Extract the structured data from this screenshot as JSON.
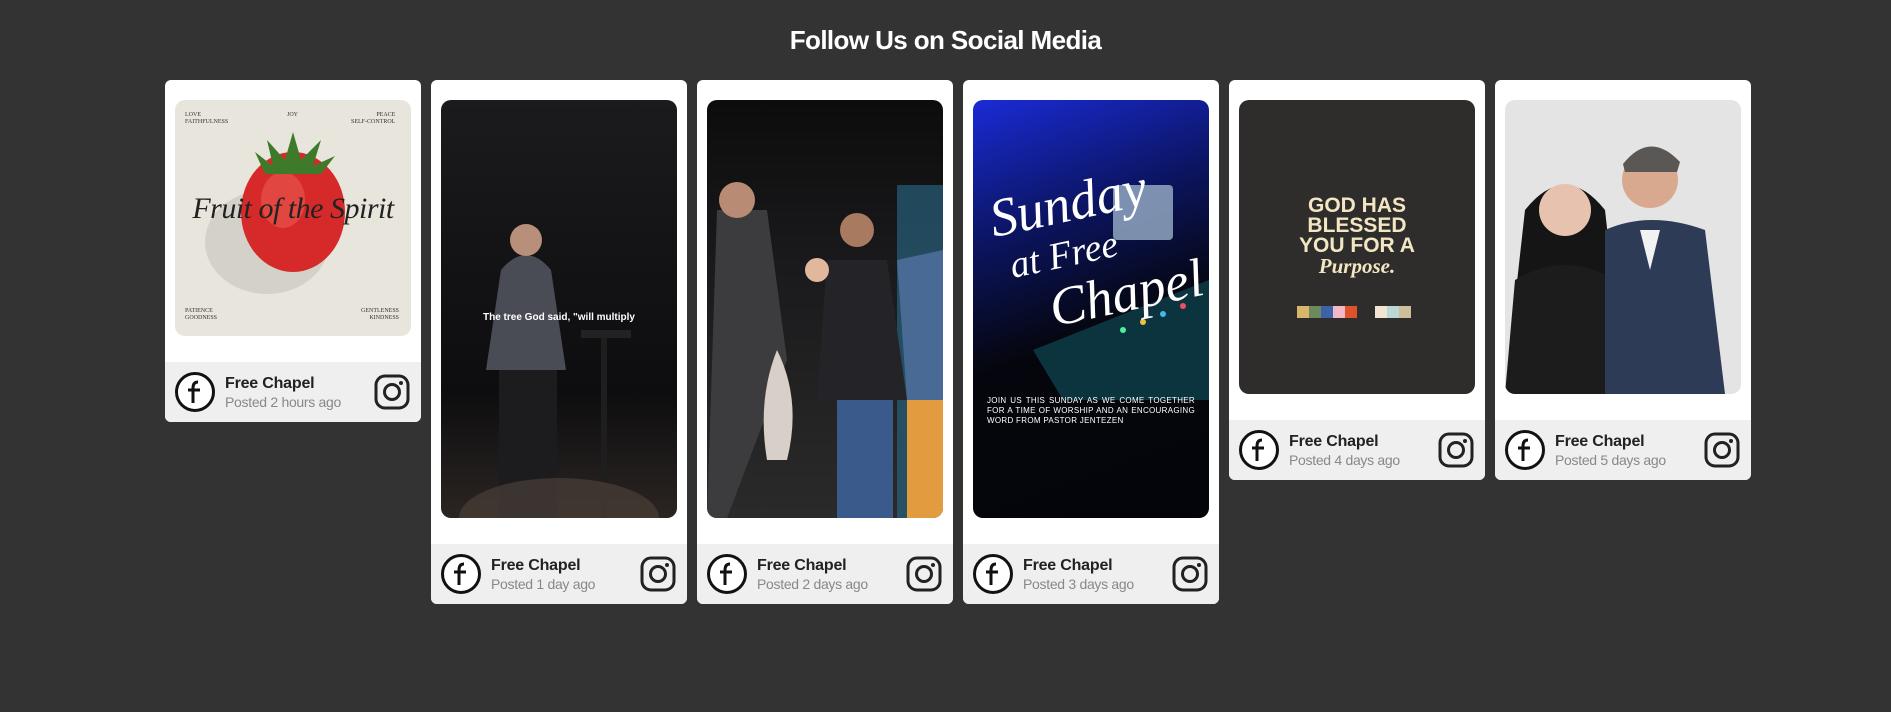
{
  "page": {
    "title": "Follow Us on Social Media"
  },
  "posts": [
    {
      "author": "Free Chapel",
      "posted": "Posted 2 hours ago",
      "image": {
        "corner_tl": "LOVE\nFAITHFULNESS",
        "corner_tc": "JOY",
        "corner_tr": "PEACE\nSELF-CONTROL",
        "script": "Fruit of the Spirit",
        "corner_bl": "PATIENCE\nGOODNESS",
        "corner_br": "GENTLENESS\nKINDNESS"
      }
    },
    {
      "author": "Free Chapel",
      "posted": "Posted 1 day ago",
      "image": {
        "caption": "The tree God said, \"will multiply"
      }
    },
    {
      "author": "Free Chapel",
      "posted": "Posted 2 days ago",
      "image": {}
    },
    {
      "author": "Free Chapel",
      "posted": "Posted 3 days ago",
      "image": {
        "script_line1": "Sunday",
        "script_line2": "at Free",
        "script_line3": "Chapel",
        "body": "JOIN US THIS SUNDAY AS WE COME TOGETHER FOR A TIME OF WORSHIP AND AN ENCOURAGING WORD FROM PASTOR JENTEZEN"
      }
    },
    {
      "author": "Free Chapel",
      "posted": "Posted 4 days ago",
      "image": {
        "line1": "GOD HAS",
        "line2": "BLESSED",
        "line3": "YOU FOR A",
        "line4": "Purpose.",
        "swatches_left": [
          "#d9b56b",
          "#6d8a5c",
          "#3c63a8",
          "#f2b8c6",
          "#e0512e"
        ],
        "swatches_right": [
          "#f2e4cf",
          "#b9d8d5",
          "#cdbf9c"
        ]
      }
    },
    {
      "author": "Free Chapel",
      "posted": "Posted 5 days ago",
      "image": {}
    }
  ],
  "colors": {
    "background": "#333333",
    "card": "#ffffff",
    "footer": "#efefef"
  },
  "icons": {
    "avatar": "free-chapel-logo-icon",
    "platform": "instagram-icon"
  }
}
